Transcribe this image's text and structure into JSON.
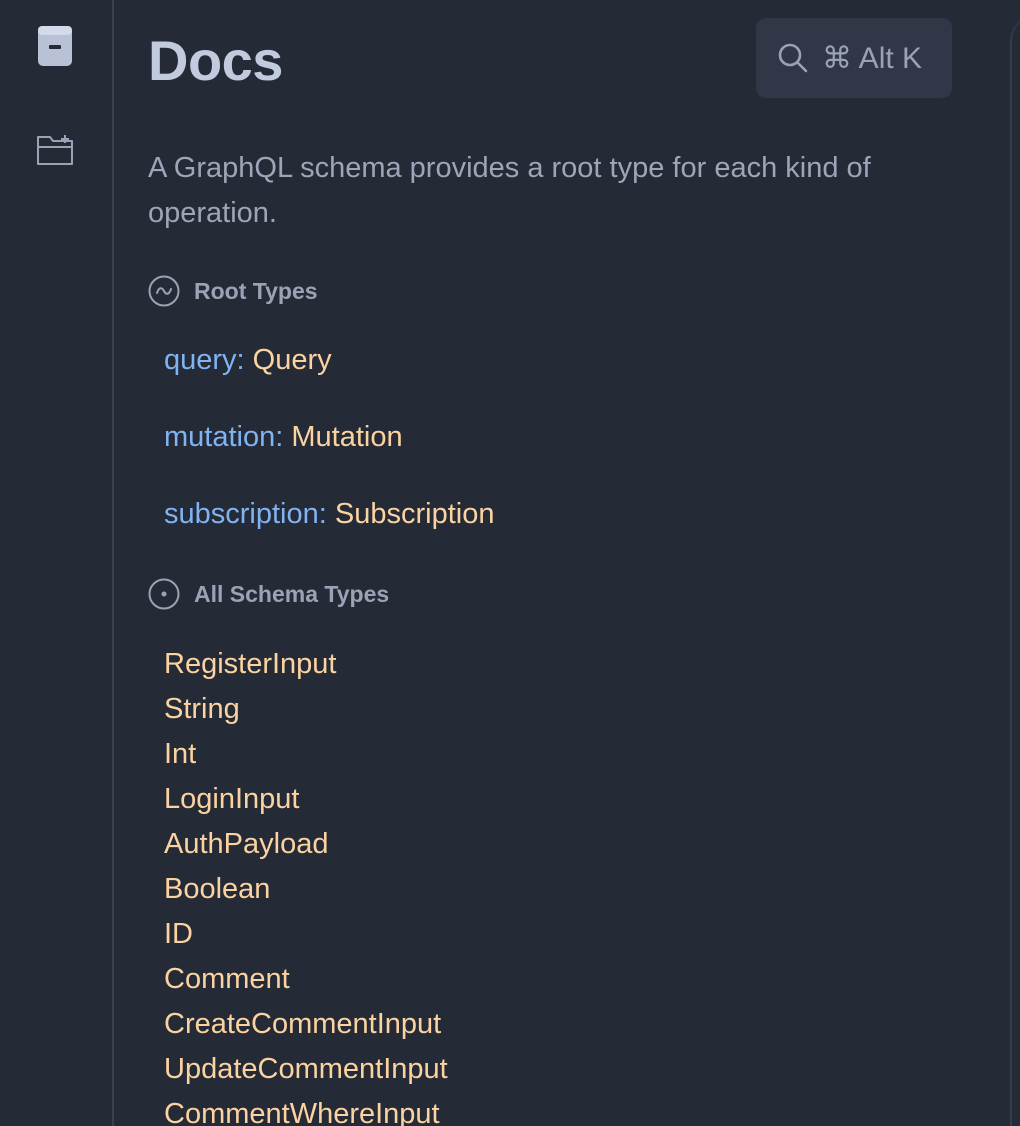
{
  "sidebar": {
    "items": [
      {
        "icon": "docs-book-icon"
      },
      {
        "icon": "add-folder-icon"
      }
    ]
  },
  "docs": {
    "title": "Docs",
    "search_shortcut": "⌘ Alt K",
    "description": "A GraphQL schema provides a root type for each kind of operation.",
    "root_types_header": "Root Types",
    "root_types": [
      {
        "field": "query",
        "colon": ":",
        "type": "Query"
      },
      {
        "field": "mutation",
        "colon": ":",
        "type": "Mutation"
      },
      {
        "field": "subscription",
        "colon": ":",
        "type": "Subscription"
      }
    ],
    "all_types_header": "All Schema Types",
    "all_types": [
      "RegisterInput",
      "String",
      "Int",
      "LoginInput",
      "AuthPayload",
      "Boolean",
      "ID",
      "Comment",
      "CreateCommentInput",
      "UpdateCommentInput",
      "CommentWhereInput"
    ]
  },
  "colors": {
    "background": "#252a37",
    "field_name": "#80b3f1",
    "type_name": "#fbd3a0",
    "muted_text": "#9da5b8",
    "title": "#c2cadd"
  }
}
